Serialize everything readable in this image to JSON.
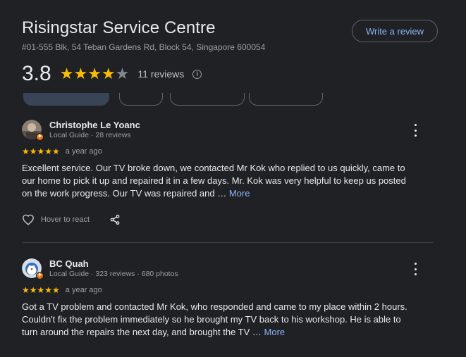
{
  "place": {
    "title": "Risingstar Service Centre",
    "address": "#01-555 Blk, 54 Teban Gardens Rd, Block 54, Singapore 600054",
    "write_review_label": "Write a review",
    "rating": "3.8",
    "rating_value": 3.8,
    "review_count": "11 reviews",
    "info_icon": "info-icon",
    "star_color": "#fbbc04",
    "link_color": "#8ab4f8"
  },
  "reviews": [
    {
      "name": "Christophe Le Yoanc",
      "meta": "Local Guide · 28 reviews",
      "stars": "★★★★★",
      "time": "a year ago",
      "text": "Excellent service. Our TV broke down, we contacted Mr Kok who replied to us quickly, came to our home to pick it up and repaired it in a few days. Mr. Kok was very helpful to keep us posted on the work progress. Our TV was repaired and … ",
      "more_label": "More",
      "react_label": "Hover to react",
      "badge": "✦"
    },
    {
      "name": "BC Quah",
      "meta": "Local Guide · 323 reviews · 680 photos",
      "stars": "★★★★★",
      "time": "a year ago",
      "text": "Got a TV problem and contacted Mr Kok, who responded and came to my place within 2 hours. Couldn't fix the problem immediately so he brought my TV back to his workshop. He is able to turn around the repairs the next day, and brought the TV … ",
      "more_label": "More",
      "badge": "✦"
    }
  ]
}
